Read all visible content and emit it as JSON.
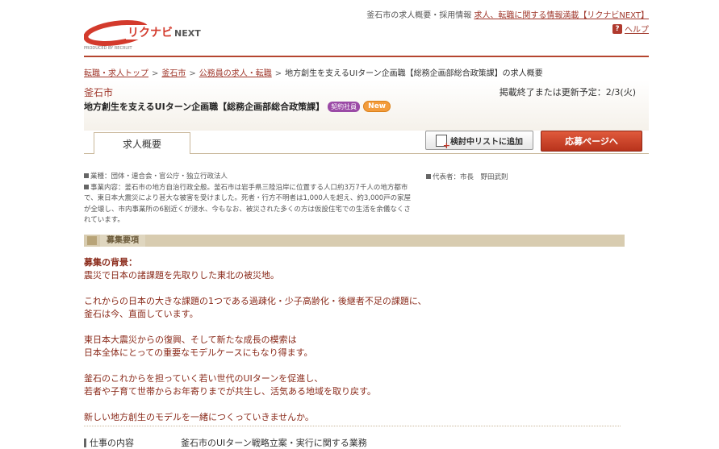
{
  "header": {
    "tagline_text": "釜石市の求人概要・採用情報",
    "tagline_link": "求人、転職に関する情報満載【リクナビNEXT】",
    "help_label": "ヘルプ",
    "logo_text": "リクナビ",
    "logo_next": "NEXT",
    "logo_produced": "PRODUCED BY RECRUIT"
  },
  "breadcrumb": {
    "items": [
      "転職・求人トップ",
      "釜石市",
      "公務員の求人・転職"
    ],
    "current": "地方創生を支えるUIターン企画職【総務企画部総合政策課】の求人概要"
  },
  "job": {
    "company": "釜石市",
    "title": "地方創生を支えるUIターン企画職【総務企画部総合政策課】",
    "badge_contract": "契約社員",
    "badge_new": "New",
    "end_date": "掲載終了または更新予定：2/3(火)"
  },
  "tabs": {
    "overview": "求人概要"
  },
  "buttons": {
    "add_list": "検討中リストに追加",
    "apply": "応募ページへ"
  },
  "company_info": {
    "industry": "業種：団体・連合会・官公庁・独立行政法人",
    "business": "事業内容：釜石市の地方自治行政全般。釜石市は岩手県三陸沿岸に位置する人口約3万7千人の地方都市で、東日本大震災により甚大な被害を受けました。死者・行方不明者は1,000人を超え、約3,000戸の家屋が全壊し、市内事業所の6割近くが浸水、今もなお、被災された多くの方は仮設住宅での生活を余儀なくされています。",
    "representative": "代表者：市長　野田武則"
  },
  "section": {
    "title": "募集要項"
  },
  "body": {
    "heading": "募集の背景：",
    "lines": [
      "震災で日本の諸課題を先取りした東北の被災地。",
      "",
      "これからの日本の大きな課題の1つである過疎化・少子高齢化・後継者不足の課題に、",
      "釜石は今、直面しています。",
      "",
      "東日本大震災からの復興、そして新たな成長の模索は",
      "日本全体にとっての重要なモデルケースにもなり得ます。",
      "",
      "釜石のこれからを担っていく若い世代のUIターンを促進し、",
      "若者や子育て世帯からお年寄りまでが共生し、活気ある地域を取り戻す。",
      "",
      "新しい地方創生のモデルを一緒につくっていきませんか。"
    ]
  },
  "detail": {
    "key": "仕事の内容",
    "value": "釜石市のUIターン戦略立案・実行に関する業務"
  },
  "colors": {
    "accent": "#b5452f",
    "text_red": "#8a2a1a",
    "section_bg": "#d8ccb0"
  }
}
